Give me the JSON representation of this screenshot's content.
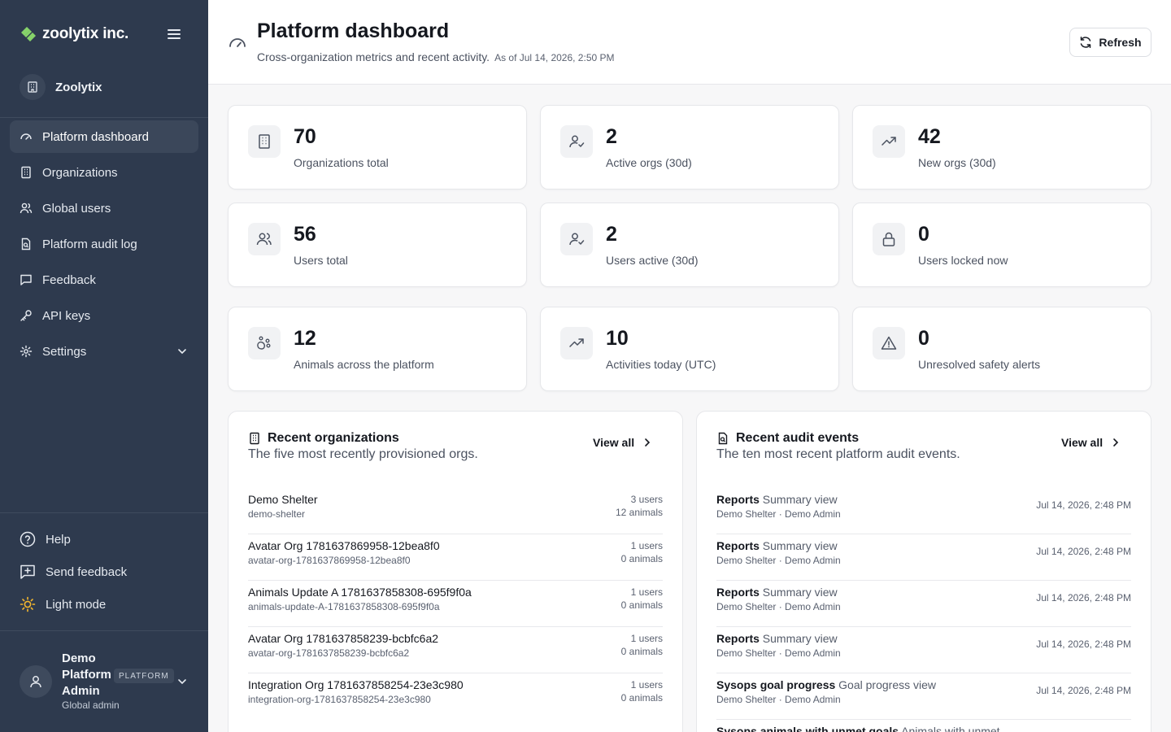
{
  "brand": {
    "name": "zoolytix inc.",
    "accent": "#86d36a"
  },
  "sidebar": {
    "org": "Zoolytix",
    "nav": [
      {
        "label": "Platform dashboard",
        "icon": "gauge-icon",
        "active": true
      },
      {
        "label": "Organizations",
        "icon": "building-icon"
      },
      {
        "label": "Global users",
        "icon": "users-icon"
      },
      {
        "label": "Platform audit log",
        "icon": "file-audit-icon"
      },
      {
        "label": "Feedback",
        "icon": "message-square-icon"
      },
      {
        "label": "API keys",
        "icon": "key-icon"
      },
      {
        "label": "Settings",
        "icon": "gear-icon"
      }
    ],
    "bottom": {
      "help": "Help",
      "send_feedback": "Send feedback",
      "light_mode": "Light mode"
    },
    "user": {
      "name": "Demo Platform Admin",
      "badge": "PLATFORM",
      "role": "Global admin"
    }
  },
  "header": {
    "title": "Platform dashboard",
    "subtitle": "Cross-organization metrics and recent activity.",
    "as_of": "As of Jul 14, 2026, 2:50 PM",
    "refresh": "Refresh"
  },
  "stats": [
    {
      "value": "70",
      "label": "Organizations total",
      "icon": "building-icon"
    },
    {
      "value": "2",
      "label": "Active orgs (30d)",
      "icon": "user-check-icon"
    },
    {
      "value": "42",
      "label": "New orgs (30d)",
      "icon": "trending-up-icon"
    },
    {
      "value": "56",
      "label": "Users total",
      "icon": "users-icon"
    },
    {
      "value": "2",
      "label": "Users active (30d)",
      "icon": "user-check-icon"
    },
    {
      "value": "0",
      "label": "Users locked now",
      "icon": "lock-icon"
    },
    {
      "value": "12",
      "label": "Animals across the platform",
      "icon": "paw-icon"
    },
    {
      "value": "10",
      "label": "Activities today (UTC)",
      "icon": "trending-up-icon"
    },
    {
      "value": "0",
      "label": "Unresolved safety alerts",
      "icon": "alert-triangle-icon"
    }
  ],
  "recent_orgs": {
    "title": "Recent organizations",
    "subtitle": "The five most recently provisioned orgs.",
    "view_all": "View all",
    "rows": [
      {
        "name": "Demo Shelter",
        "slug": "demo-shelter",
        "users": "3 users",
        "animals": "12 animals"
      },
      {
        "name": "Avatar Org 1781637869958-12bea8f0",
        "slug": "avatar-org-1781637869958-12bea8f0",
        "users": "1 users",
        "animals": "0 animals"
      },
      {
        "name": "Animals Update A 1781637858308-695f9f0a",
        "slug": "animals-update-A-1781637858308-695f9f0a",
        "users": "1 users",
        "animals": "0 animals"
      },
      {
        "name": "Avatar Org 1781637858239-bcbfc6a2",
        "slug": "avatar-org-1781637858239-bcbfc6a2",
        "users": "1 users",
        "animals": "0 animals"
      },
      {
        "name": "Integration Org 1781637858254-23e3c980",
        "slug": "integration-org-1781637858254-23e3c980",
        "users": "1 users",
        "animals": "0 animals"
      }
    ]
  },
  "recent_audit": {
    "title": "Recent audit events",
    "subtitle": "The ten most recent platform audit events.",
    "view_all": "View all",
    "rows": [
      {
        "event": "Reports",
        "detail": "Summary view",
        "meta": "Demo Shelter · Demo Admin",
        "time": "Jul 14, 2026, 2:48 PM"
      },
      {
        "event": "Reports",
        "detail": "Summary view",
        "meta": "Demo Shelter · Demo Admin",
        "time": "Jul 14, 2026, 2:48 PM"
      },
      {
        "event": "Reports",
        "detail": "Summary view",
        "meta": "Demo Shelter · Demo Admin",
        "time": "Jul 14, 2026, 2:48 PM"
      },
      {
        "event": "Reports",
        "detail": "Summary view",
        "meta": "Demo Shelter · Demo Admin",
        "time": "Jul 14, 2026, 2:48 PM"
      },
      {
        "event": "Sysops goal progress",
        "detail": "Goal progress view",
        "meta": "Demo Shelter · Demo Admin",
        "time": "Jul 14, 2026, 2:48 PM"
      },
      {
        "event": "Sysops animals with unmet goals",
        "detail": "Animals with unmet",
        "meta": "",
        "time": ""
      }
    ]
  }
}
